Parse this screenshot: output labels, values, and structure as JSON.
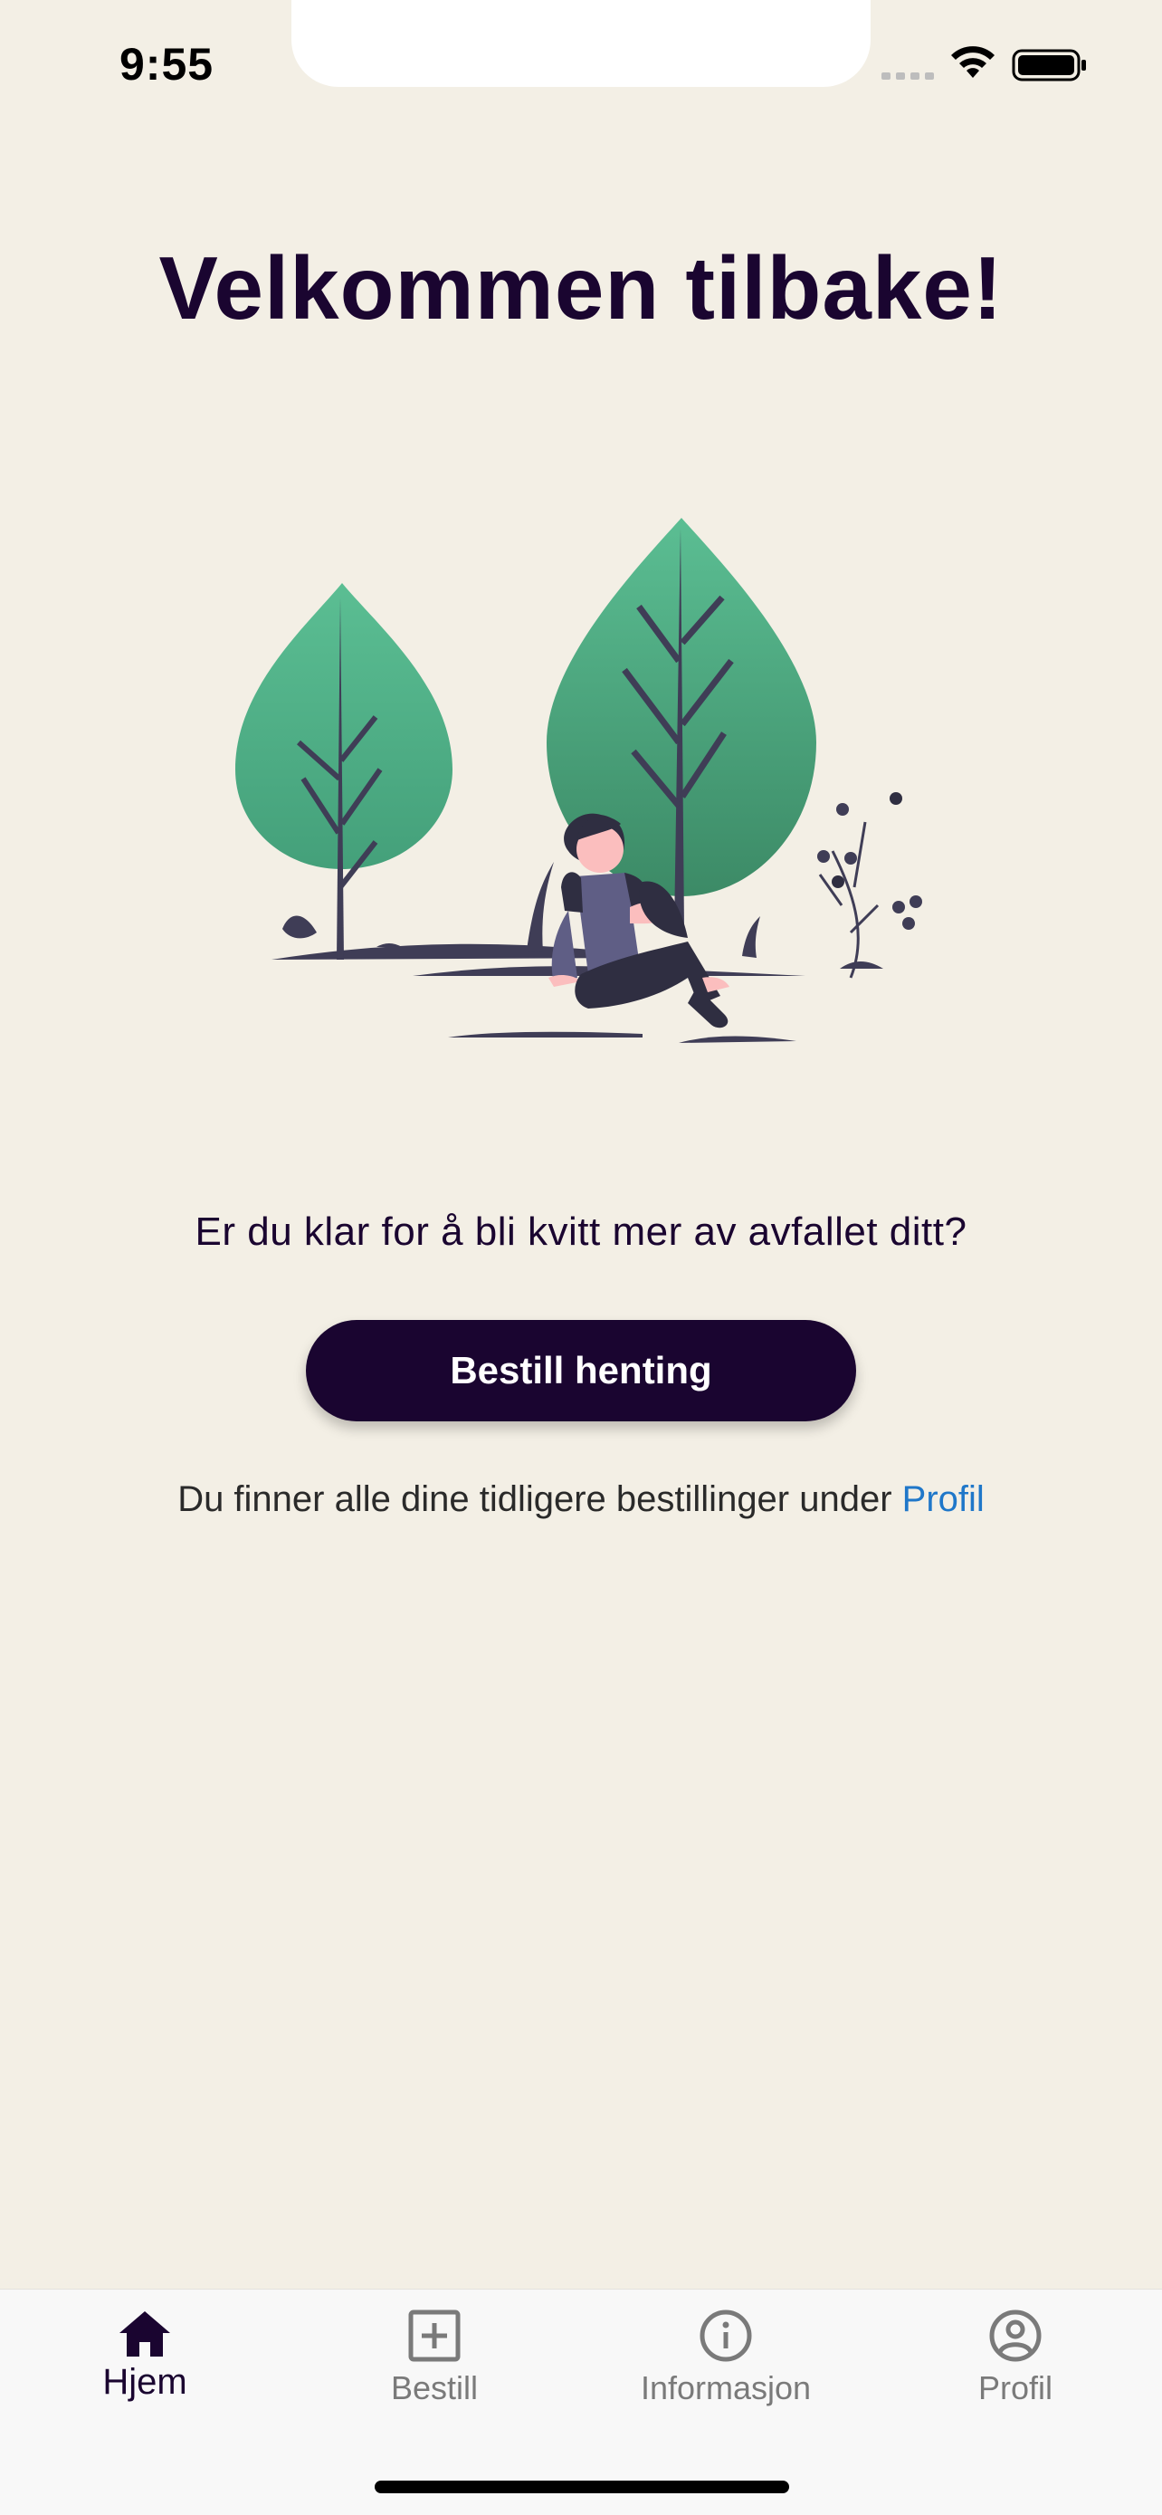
{
  "status_bar": {
    "time": "9:55",
    "signal_icon": "cellular-signal-icon",
    "wifi_icon": "wifi-icon",
    "battery_icon": "battery-icon"
  },
  "main": {
    "title": "Velkommen tilbake!",
    "illustration": "person-sitting-under-trees-illustration",
    "question": "Er du klar for å bli kvitt mer av avfallet ditt?",
    "order_button": "Bestill henting",
    "info_prefix": "Du finner alle dine tidligere bestillinger under",
    "info_link": "Profil"
  },
  "tab_bar": {
    "items": [
      {
        "label": "Hjem",
        "icon": "home-icon",
        "active": true
      },
      {
        "label": "Bestill",
        "icon": "plus-square-icon",
        "active": false
      },
      {
        "label": "Informasjon",
        "icon": "info-circle-icon",
        "active": false
      },
      {
        "label": "Profil",
        "icon": "user-circle-icon",
        "active": false
      }
    ]
  },
  "colors": {
    "background": "#F3EFE5",
    "primary": "#1A0530",
    "link": "#1F77C9",
    "tree_green": "#4FAE86"
  }
}
